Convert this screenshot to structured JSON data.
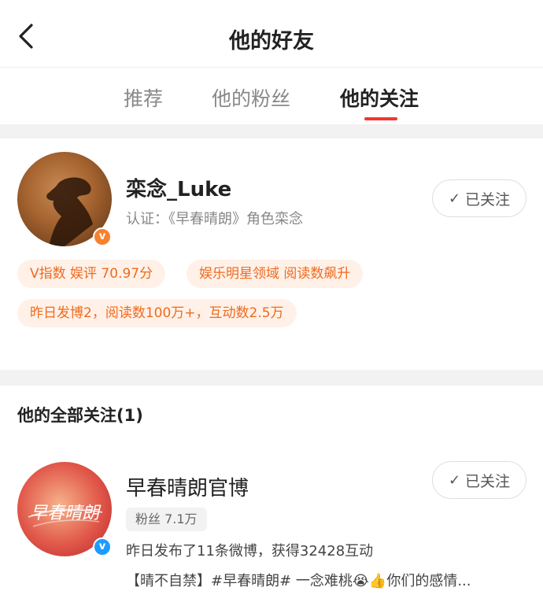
{
  "header": {
    "title": "他的好友"
  },
  "tabs": [
    {
      "label": "推荐"
    },
    {
      "label": "他的粉丝"
    },
    {
      "label": "他的关注"
    }
  ],
  "profile": {
    "name": "栾念_Luke",
    "verification": "认证：《早春晴朗》角色栾念",
    "follow_label": "已关注",
    "badge_color": "#f7812f",
    "tags": [
      "V指数 娱评 70.97分",
      "娱乐明星领域 阅读数飙升",
      "昨日发博2，阅读数100万+，互动数2.5万"
    ]
  },
  "following": {
    "title": "他的全部关注(1)",
    "items": [
      {
        "name": "早春晴朗官博",
        "fans": "粉丝 7.1万",
        "activity": "昨日发布了11条微博，获得32428互动",
        "snippet": "【晴不自禁】#早春晴朗# 一念难桃😭👍你们的感情...",
        "follow_label": "已关注",
        "avatar_text": "早春晴朗",
        "badge_color": "#1e9bff"
      }
    ]
  },
  "accent_color": "#f43530"
}
